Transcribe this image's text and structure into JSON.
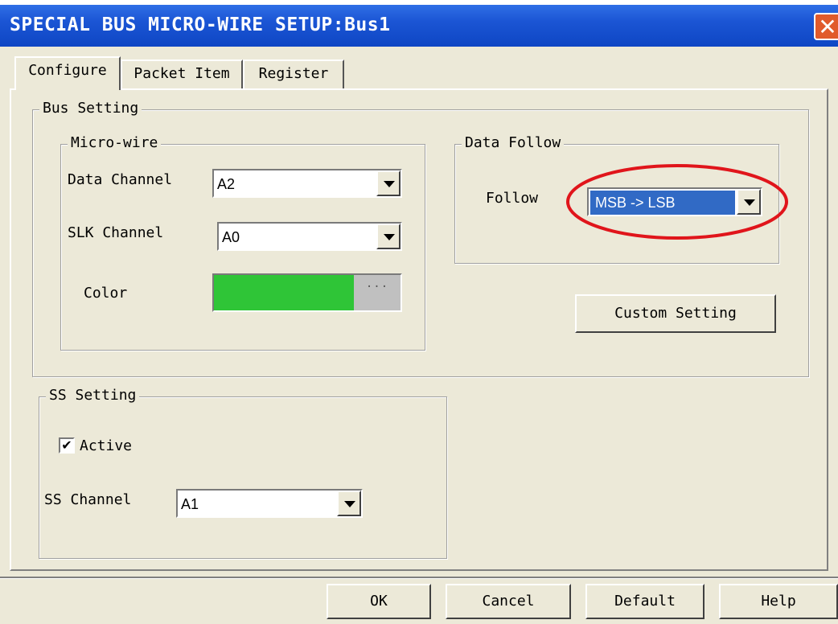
{
  "window": {
    "title": "SPECIAL BUS MICRO-WIRE SETUP:Bus1",
    "close_glyph": "✕"
  },
  "tabs": [
    {
      "label": "Configure",
      "active": true
    },
    {
      "label": "Packet Item",
      "active": false
    },
    {
      "label": "Register",
      "active": false
    }
  ],
  "bus_setting": {
    "legend": "Bus Setting",
    "micro_wire": {
      "legend": "Micro-wire",
      "data_channel": {
        "label": "Data Channel",
        "value": "A2"
      },
      "slk_channel": {
        "label": "SLK Channel",
        "value": "A0"
      },
      "color": {
        "label": "Color",
        "value": "#2fc537",
        "button_glyph": "···"
      }
    },
    "data_follow": {
      "legend": "Data Follow",
      "follow": {
        "label": "Follow",
        "value": "MSB -> LSB",
        "highlight_color": "#e0151b"
      }
    },
    "custom_setting_button": "Custom Setting"
  },
  "ss_setting": {
    "legend": "SS Setting",
    "active": {
      "label": "Active",
      "checked": true,
      "check_glyph": "✔"
    },
    "ss_channel": {
      "label": "SS Channel",
      "value": "A1"
    }
  },
  "buttons": {
    "ok": "OK",
    "cancel": "Cancel",
    "default": "Default",
    "help": "Help"
  },
  "colors": {
    "titlebar": "#1b55d4",
    "dialog_bg": "#ece9d8",
    "selection": "#316ac5"
  }
}
